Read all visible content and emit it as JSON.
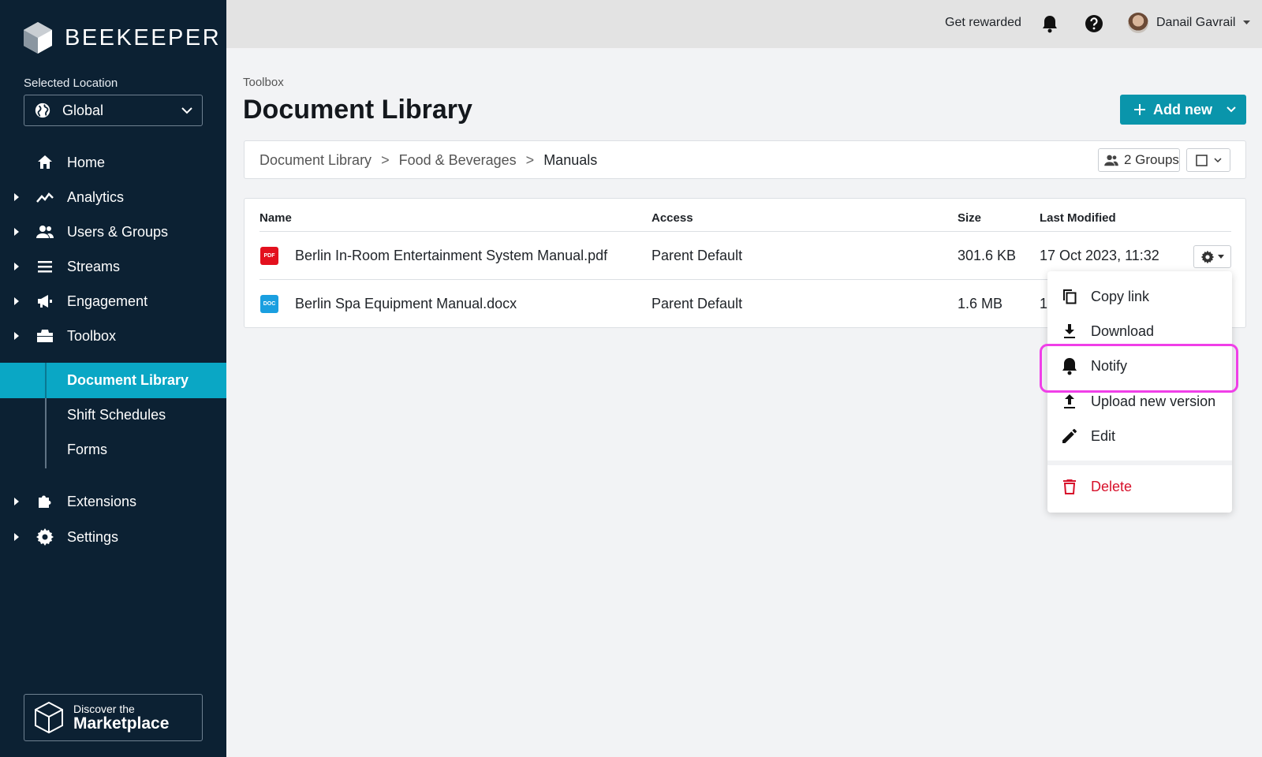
{
  "brand": {
    "name": "BEEKEEPER"
  },
  "location": {
    "label": "Selected Location",
    "value": "Global"
  },
  "nav": {
    "home": "Home",
    "analytics": "Analytics",
    "users_groups": "Users & Groups",
    "streams": "Streams",
    "engagement": "Engagement",
    "toolbox": "Toolbox",
    "sub": [
      "Document Library",
      "Shift Schedules",
      "Forms"
    ],
    "extensions": "Extensions",
    "settings": "Settings"
  },
  "marketplace": {
    "line1": "Discover the",
    "line2": "Marketplace"
  },
  "topbar": {
    "get_rewarded": "Get rewarded",
    "user_name": "Danail Gavrail"
  },
  "page": {
    "parent": "Toolbox",
    "title": "Document Library",
    "add_new": "Add new",
    "breadcrumb": {
      "root": "Document Library",
      "middle": "Food & Beverages",
      "current": "Manuals",
      "separator": ">"
    },
    "groups": "2 Groups"
  },
  "table": {
    "headers": {
      "name": "Name",
      "access": "Access",
      "size": "Size",
      "modified": "Last Modified"
    },
    "rows": [
      {
        "type": "PDF",
        "type_color": "#e3101e",
        "name": "Berlin In-Room Entertainment System Manual.pdf",
        "access": "Parent Default",
        "size": "301.6 KB",
        "modified": "17 Oct 2023, 11:32"
      },
      {
        "type": "DOC",
        "type_color": "#1a9fe0",
        "name": "Berlin Spa Equipment Manual.docx",
        "access": "Parent Default",
        "size": "1.6 MB",
        "modified": "1"
      }
    ]
  },
  "menu": {
    "copy_link": "Copy link",
    "download": "Download",
    "notify": "Notify",
    "upload": "Upload new version",
    "edit": "Edit",
    "delete": "Delete"
  },
  "colors": {
    "sidebar": "#0c2133",
    "accent": "#0aa7c5",
    "button": "#0a95ab",
    "danger": "#d7102a",
    "highlight": "#f03fe8"
  }
}
